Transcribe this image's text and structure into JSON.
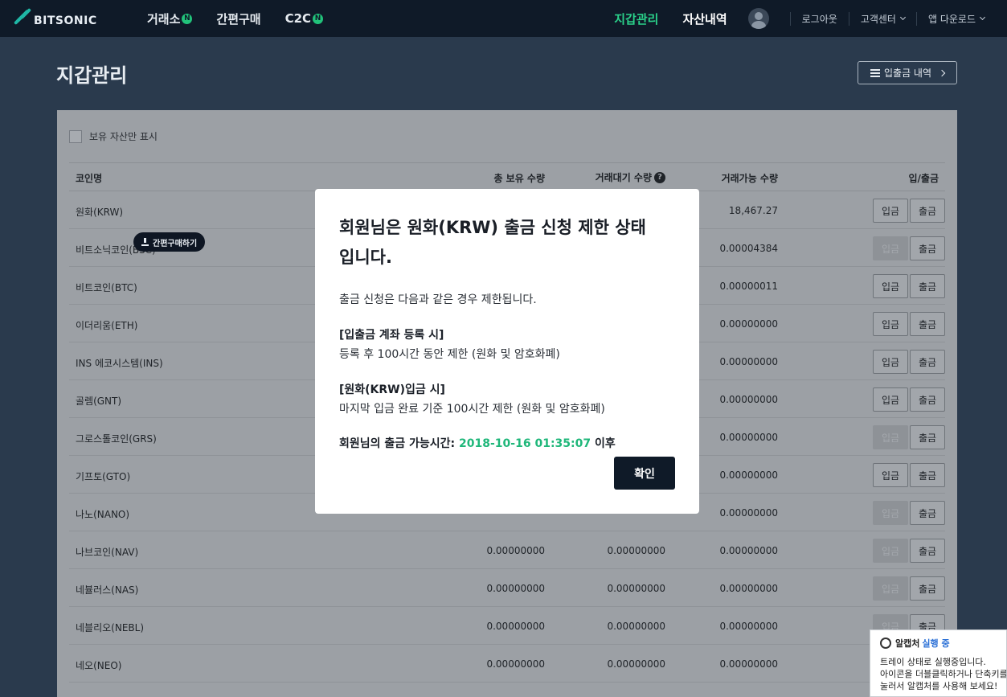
{
  "header": {
    "logo_text": "BITSONIC",
    "nav_left": [
      {
        "label": "거래소",
        "badge": "N"
      },
      {
        "label": "간편구매",
        "badge": ""
      },
      {
        "label": "C2C",
        "badge": "N"
      }
    ],
    "nav_wallet": "지갑관리",
    "nav_assets": "자산내역",
    "logout": "로그아웃",
    "support": "고객센터",
    "app_download": "앱 다운로드"
  },
  "page": {
    "title": "지갑관리",
    "history_button": "입출금 내역",
    "hold_only_label": "보유 자산만 표시"
  },
  "table": {
    "headers": {
      "coin": "코인명",
      "total": "총 보유 수량",
      "pending": "거래대기 수량",
      "available": "거래가능 수량",
      "io": "입/출금"
    },
    "help_glyph": "?",
    "deposit_label": "입금",
    "withdraw_label": "출금",
    "quick_buy_label": "간편구매하기",
    "rows": [
      {
        "name": "원화(KRW)",
        "total": "",
        "pending": "",
        "available": "18,467.27",
        "deposit_enabled": true
      },
      {
        "name": "비트소닉코인(BSC)",
        "total": "",
        "pending": "",
        "available": "0.00004384",
        "deposit_enabled": false
      },
      {
        "name": "비트코인(BTC)",
        "total": "",
        "pending": "",
        "available": "0.00000011",
        "deposit_enabled": true
      },
      {
        "name": "이더리움(ETH)",
        "total": "",
        "pending": "",
        "available": "0.00000000",
        "deposit_enabled": true
      },
      {
        "name": "INS 에코시스템(INS)",
        "total": "",
        "pending": "",
        "available": "0.00000000",
        "deposit_enabled": true
      },
      {
        "name": "골렘(GNT)",
        "total": "",
        "pending": "",
        "available": "0.00000000",
        "deposit_enabled": true
      },
      {
        "name": "그로스톨코인(GRS)",
        "total": "",
        "pending": "",
        "available": "0.00000000",
        "deposit_enabled": false
      },
      {
        "name": "기프토(GTO)",
        "total": "",
        "pending": "",
        "available": "0.00000000",
        "deposit_enabled": true
      },
      {
        "name": "나노(NANO)",
        "total": "",
        "pending": "",
        "available": "0.00000000",
        "deposit_enabled": false
      },
      {
        "name": "나브코인(NAV)",
        "total": "0.00000000",
        "pending": "0.00000000",
        "available": "0.00000000",
        "deposit_enabled": false
      },
      {
        "name": "네뷸러스(NAS)",
        "total": "0.00000000",
        "pending": "0.00000000",
        "available": "0.00000000",
        "deposit_enabled": false
      },
      {
        "name": "네블리오(NEBL)",
        "total": "0.00000000",
        "pending": "0.00000000",
        "available": "0.00000000",
        "deposit_enabled": false
      },
      {
        "name": "네오(NEO)",
        "total": "0.00000000",
        "pending": "0.00000000",
        "available": "0.00000000",
        "deposit_enabled": false
      }
    ]
  },
  "modal": {
    "title_line1": "회원님은 원화(KRW) 출금 신청 제한 상태",
    "title_line2": "입니다.",
    "lead": "출금 신청은 다음과 같은 경우 제한됩니다.",
    "sec1_title": "[입출금 계좌 등록 시]",
    "sec1_body": "등록 후 100시간 동안 제한 (원화 및 암호화폐)",
    "sec2_title": "[원화(KRW)입금 시]",
    "sec2_body": "마지막 입금 완료 기준 100시간 제한 (원화 및 암호화폐)",
    "time_label": "회원님의 출금 가능시간:",
    "time_value": "2018-10-16 01:35:07",
    "time_suffix": "이후",
    "confirm": "확인"
  },
  "tray": {
    "app_name": "알캡처",
    "status": "실행 중",
    "line1": "트레이 상태로 실행중입니다.",
    "line2": "아이콘을 더블클릭하거나 단축키를",
    "line3": "눌러서 알캡처를 사용해 보세요!"
  },
  "colors": {
    "header_bg": "#0f1a28",
    "accent_green": "#2ad18a",
    "page_bg": "#2a3a4d"
  }
}
